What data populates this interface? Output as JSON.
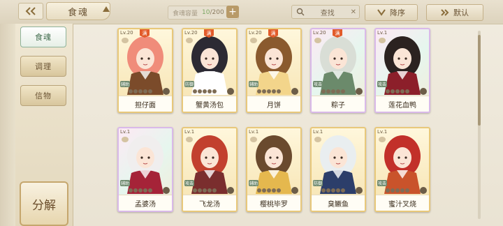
{
  "header": {
    "title": "食魂",
    "capacity_label": "食魂容量",
    "capacity_count": "10",
    "capacity_max": "/200",
    "search_label": "查找",
    "sort_label": "降序",
    "default_label": "默认"
  },
  "sidebar": {
    "tabs": [
      {
        "label": "食魂",
        "active": true
      },
      {
        "label": "调理",
        "active": false
      },
      {
        "label": "信物",
        "active": false
      }
    ],
    "decompose_label": "分解"
  },
  "cards": [
    {
      "level": "Lv.20",
      "full": "满",
      "name": "担仔面",
      "role": "辅助",
      "hair": "#f08c7a",
      "coat": "#7b4b2a"
    },
    {
      "level": "Lv.20",
      "full": "满",
      "name": "蟹黄汤包",
      "role": "防御",
      "hair": "#2c2a33",
      "coat": "#ffffff"
    },
    {
      "level": "Lv.20",
      "full": "满",
      "name": "月饼",
      "role": "辅助",
      "hair": "#8a5a2e",
      "coat": "#f3d58b"
    },
    {
      "level": "Lv.20",
      "full": "满",
      "name": "粽子",
      "role": "攻击",
      "hair": "#d9ded6",
      "coat": "#6b8a6b"
    },
    {
      "level": "Lv.1",
      "full": "",
      "name": "莲花血鸭",
      "role": "攻击",
      "hair": "#2b2220",
      "coat": "#8c1f2a"
    },
    {
      "level": "Lv.1",
      "full": "",
      "name": "孟婆汤",
      "role": "辅助",
      "hair": "#f0eeee",
      "coat": "#a52338"
    },
    {
      "level": "Lv.1",
      "full": "",
      "name": "飞龙汤",
      "role": "攻击",
      "hair": "#c2402e",
      "coat": "#7a2e2e"
    },
    {
      "level": "Lv.1",
      "full": "",
      "name": "樱桃毕罗",
      "role": "辅助",
      "hair": "#6a4a2e",
      "coat": "#e5b84e"
    },
    {
      "level": "Lv.1",
      "full": "",
      "name": "臭鳜鱼",
      "role": "防御",
      "hair": "#e9eef0",
      "coat": "#2c3e6a"
    },
    {
      "level": "Lv.1",
      "full": "",
      "name": "蜜汁叉烧",
      "role": "攻击",
      "hair": "#c2302a",
      "coat": "#c9532b"
    }
  ]
}
